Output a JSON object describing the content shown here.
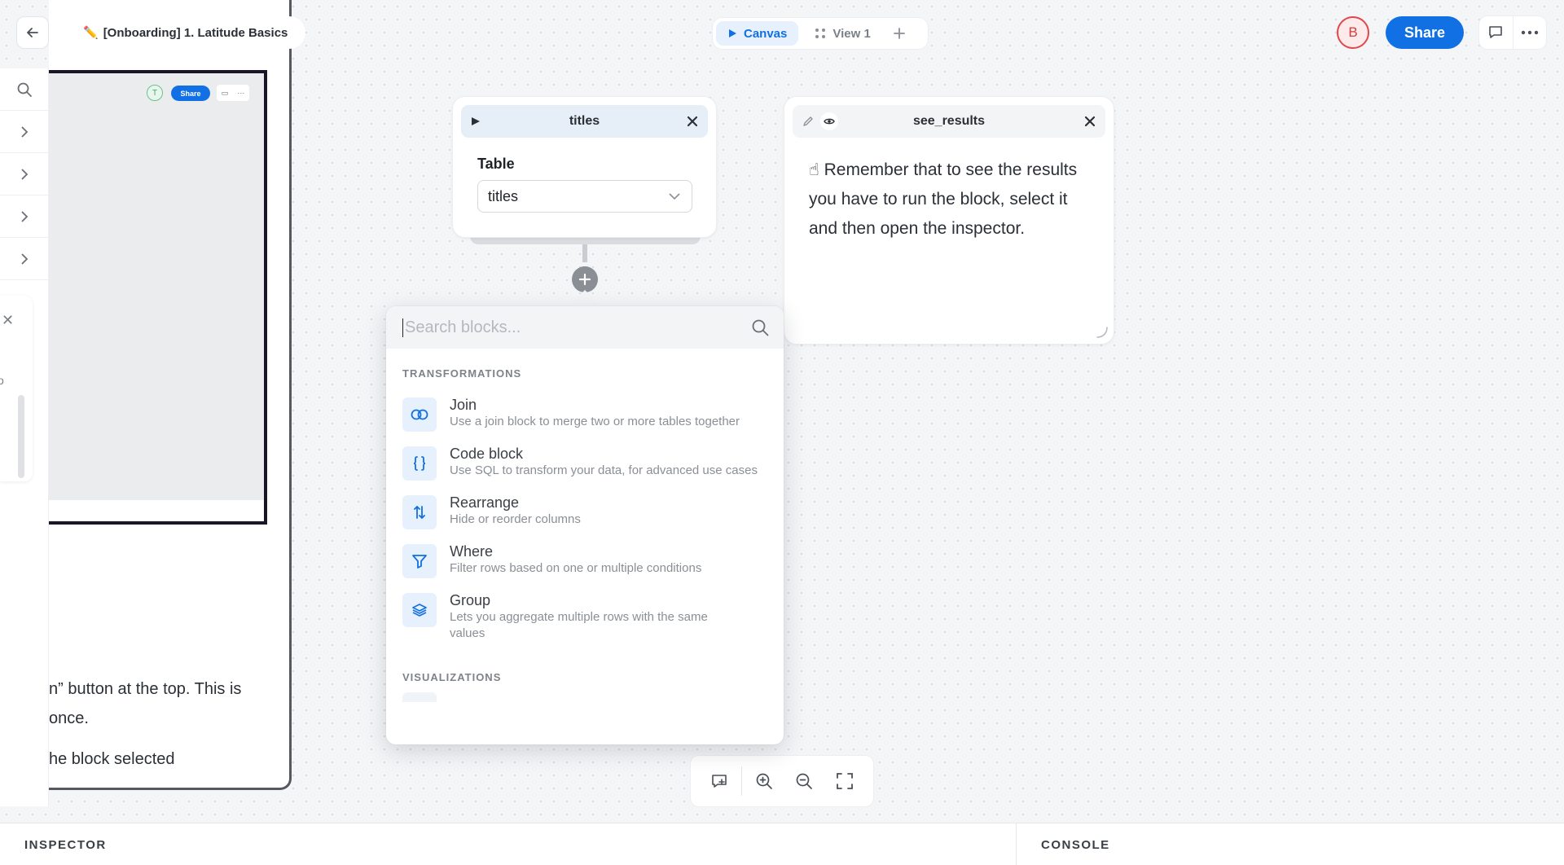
{
  "header": {
    "title_icon": "pencil-emoji",
    "doc_title": "[Onboarding] 1. Latitude Basics",
    "tabs": [
      {
        "label": "Canvas",
        "icon": "play-icon",
        "active": true
      },
      {
        "label": "View 1",
        "icon": "grid-dots-icon",
        "active": false
      }
    ],
    "avatar_initial": "B",
    "share_label": "Share"
  },
  "left_panel": {
    "mini_preview": {
      "avatar_initial": "T",
      "share_label": "Share",
      "more": "···"
    },
    "text_lines": [
      "n” button at the top. This is",
      "once.",
      "he block selected"
    ],
    "floating_card": {
      "close": "✕",
      "partial_char": "o"
    }
  },
  "blocks": {
    "titles": {
      "name": "titles",
      "field_label": "Table",
      "field_value": "titles"
    },
    "see_results": {
      "name": "see_results",
      "emoji": "☝",
      "text": "Remember that to see the results you have to run the block, select it and then open the inspector."
    }
  },
  "block_search": {
    "placeholder": "Search blocks...",
    "sections": {
      "transformations": "TRANSFORMATIONS",
      "visualizations": "VISUALIZATIONS"
    },
    "items": [
      {
        "title": "Join",
        "desc": "Use a join block to merge two or more tables together",
        "icon": "join-icon"
      },
      {
        "title": "Code block",
        "desc": "Use SQL to transform your data, for advanced use cases",
        "icon": "code-braces-icon"
      },
      {
        "title": "Rearrange",
        "desc": "Hide or reorder columns",
        "icon": "rearrange-icon"
      },
      {
        "title": "Where",
        "desc": "Filter rows based on one or multiple conditions",
        "icon": "filter-icon"
      },
      {
        "title": "Group",
        "desc": "Lets you aggregate multiple rows with the same values",
        "icon": "layers-icon"
      }
    ]
  },
  "bottom_dock": {
    "inspector_label": "INSPECTOR",
    "console_label": "CONSOLE"
  },
  "colors": {
    "accent": "#1170e3",
    "canvas_bg": "#f4f5f7",
    "avatar_red": "#e0474c"
  }
}
